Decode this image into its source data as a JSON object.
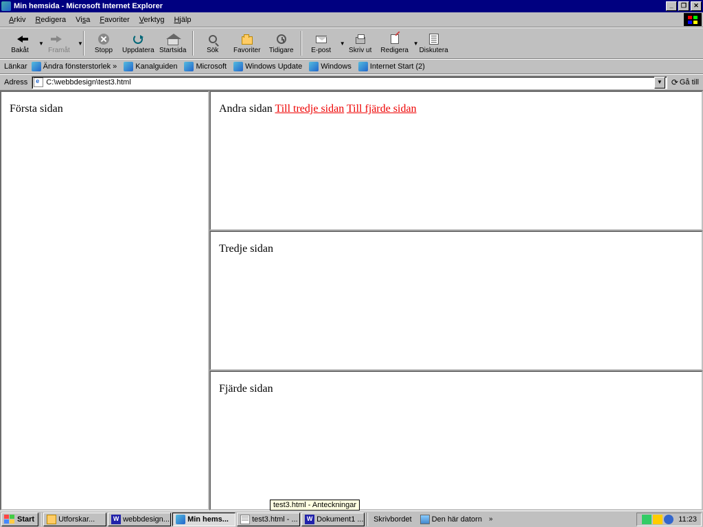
{
  "window": {
    "title": "Min hemsida - Microsoft Internet Explorer"
  },
  "menu": {
    "arkiv": "Arkiv",
    "redigera": "Redigera",
    "visa": "Visa",
    "favoriter": "Favoriter",
    "verktyg": "Verktyg",
    "hjalp": "Hjälp"
  },
  "toolbar": {
    "back": "Bakåt",
    "forward": "Framåt",
    "stop": "Stopp",
    "refresh": "Uppdatera",
    "home": "Startsida",
    "search": "Sök",
    "favorites": "Favoriter",
    "history": "Tidigare",
    "mail": "E-post",
    "print": "Skriv ut",
    "edit": "Redigera",
    "discuss": "Diskutera"
  },
  "links": {
    "label": "Länkar",
    "resize": "Ändra fönsterstorlek »",
    "kanal": "Kanalguiden",
    "ms": "Microsoft",
    "wu": "Windows Update",
    "win": "Windows",
    "istart": "Internet Start (2)"
  },
  "address": {
    "label": "Adress",
    "value": "C:\\webbdesign\\test3.html",
    "go": "Gå till"
  },
  "frames": {
    "first": "Första sidan",
    "second": "Andra sidan",
    "link3": "Till tredje sidan",
    "link4": "Till fjärde sidan",
    "third": "Tredje sidan",
    "fourth": "Fjärde sidan"
  },
  "taskbar": {
    "start": "Start",
    "t1": "Utforskar...",
    "t2": "webbdesign...",
    "t3": "Min hems...",
    "t4": "test3.html - ...",
    "t5": "Dokument1 ...",
    "desk": "Skrivbordet",
    "mycomp": "Den här datorn",
    "clock": "11:23"
  },
  "tooltip": "test3.html - Anteckningar"
}
